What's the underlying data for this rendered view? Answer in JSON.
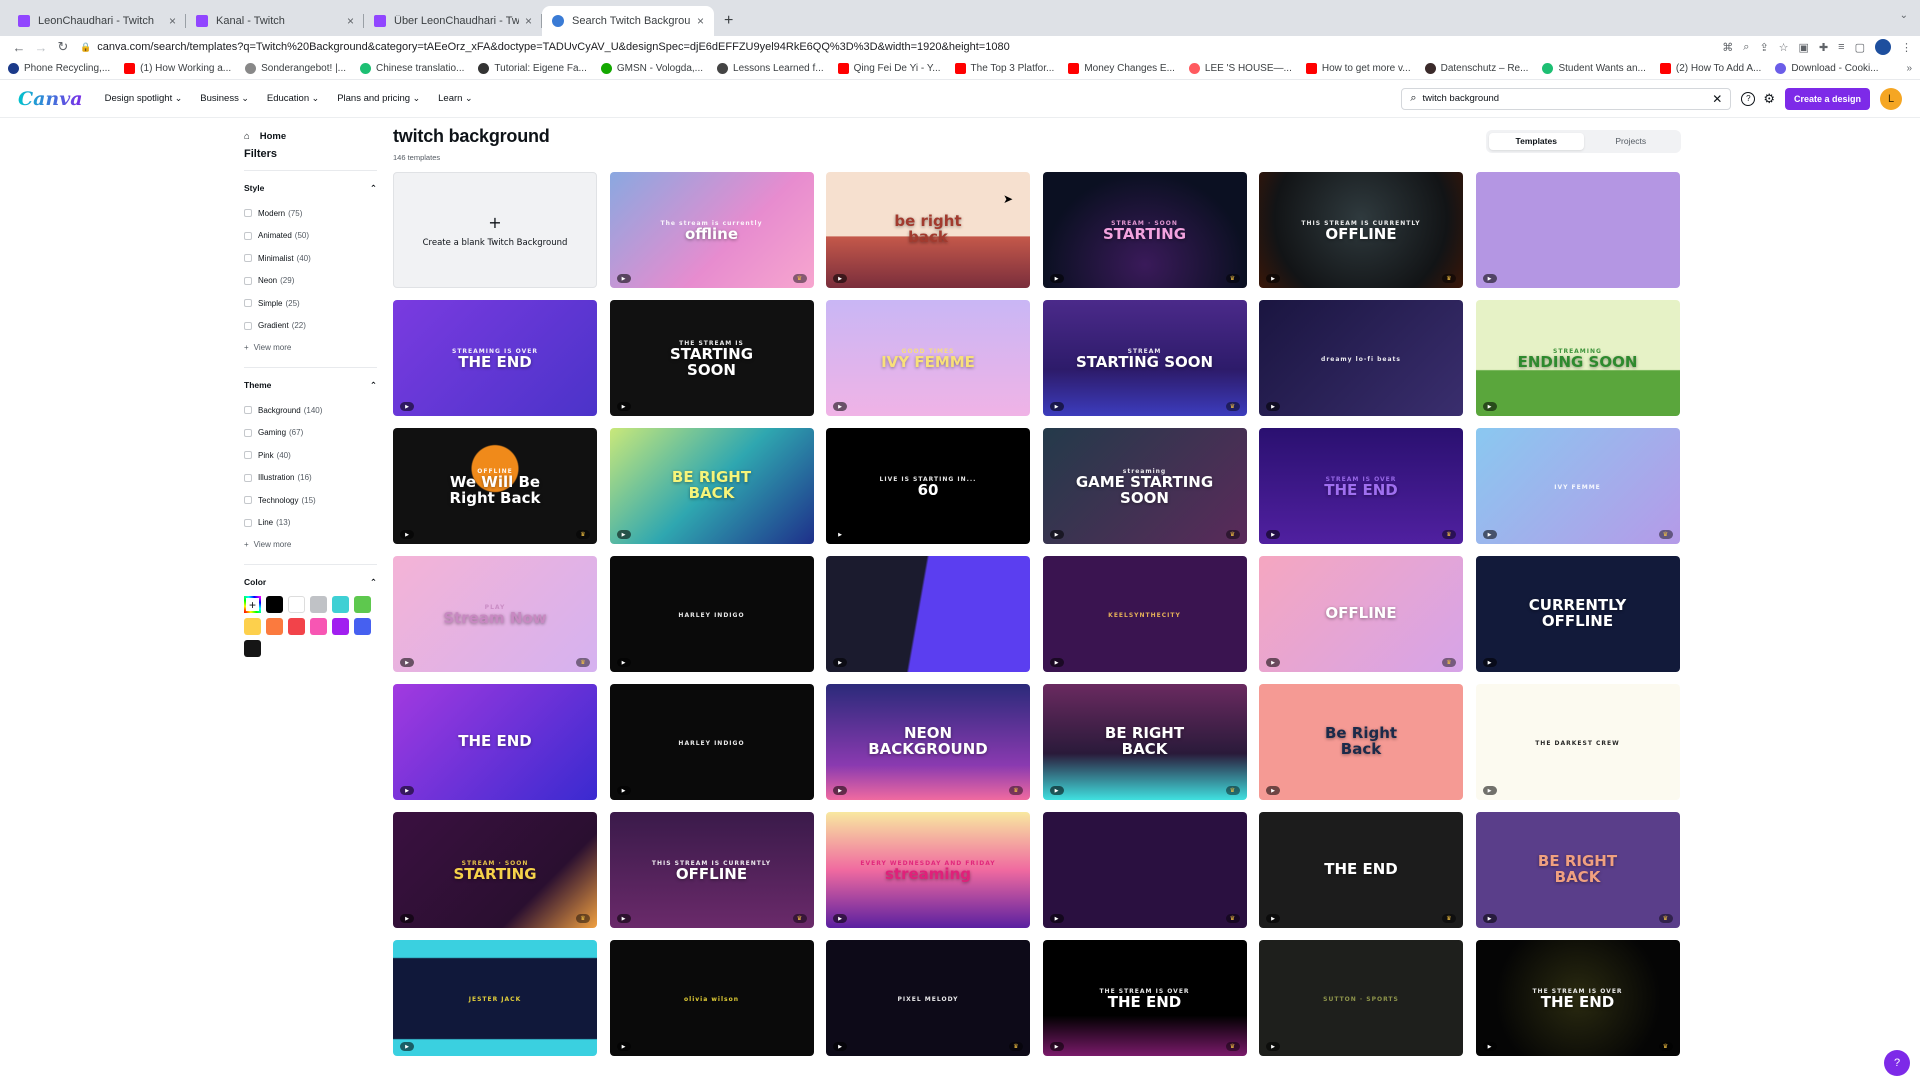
{
  "browser": {
    "tabs": [
      {
        "title": "LeonChaudhari - Twitch",
        "icon": "twitch-icon",
        "active": false
      },
      {
        "title": "Kanal - Twitch",
        "icon": "twitch-icon",
        "active": false
      },
      {
        "title": "Über LeonChaudhari - Twitch",
        "icon": "twitch-icon",
        "active": false
      },
      {
        "title": "Search Twitch Background - C",
        "icon": "canva-icon",
        "active": true
      }
    ],
    "close_glyph": "×",
    "new_tab_glyph": "+",
    "url_host": "canva.com",
    "url_rest": "/search/templates?q=Twitch%20Background&category=tAEeOrz_xFA&doctype=TADUvCyAV_U&designSpec=djE6dEFFZU9yel94RkE6QQ%3D%3D&width=1920&height=1080",
    "bookmarks": [
      {
        "label": "Phone Recycling,...",
        "icon": "o2-icon"
      },
      {
        "label": "(1) How Working a...",
        "icon": "youtube-icon"
      },
      {
        "label": "Sonderangebot! |...",
        "icon": "globe-icon"
      },
      {
        "label": "Chinese translatio...",
        "icon": "fiverr-icon"
      },
      {
        "label": "Tutorial: Eigene Fa...",
        "icon": "hashtag-icon"
      },
      {
        "label": "GMSN - Vologda,...",
        "icon": "upwork-icon"
      },
      {
        "label": "Lessons Learned f...",
        "icon": "eir-icon"
      },
      {
        "label": "Qing Fei De Yi - Y...",
        "icon": "youtube-icon"
      },
      {
        "label": "The Top 3 Platfor...",
        "icon": "youtube-icon"
      },
      {
        "label": "Money Changes E...",
        "icon": "youtube-icon"
      },
      {
        "label": "LEE 'S HOUSE—...",
        "icon": "airbnb-icon"
      },
      {
        "label": "How to get more v...",
        "icon": "youtube-icon"
      },
      {
        "label": "Datenschutz – Re...",
        "icon": "image-icon"
      },
      {
        "label": "Student Wants an...",
        "icon": "teachable-icon"
      },
      {
        "label": "(2) How To Add A...",
        "icon": "youtube-icon"
      },
      {
        "label": "Download - Cooki...",
        "icon": "ring-icon"
      }
    ],
    "bookmarks_more": "»"
  },
  "header": {
    "logo": "Canva",
    "nav": [
      "Design spotlight",
      "Business",
      "Education",
      "Plans and pricing",
      "Learn"
    ],
    "search_value": "twitch background",
    "help_glyph": "?",
    "create_label": "Create a design",
    "user_initial": "L",
    "accent": "#7d2ae8"
  },
  "sidebar": {
    "home_label": "Home",
    "filters_title": "Filters",
    "style": {
      "title": "Style",
      "options": [
        {
          "label": "Modern",
          "count": "(75)"
        },
        {
          "label": "Animated",
          "count": "(50)"
        },
        {
          "label": "Minimalist",
          "count": "(40)"
        },
        {
          "label": "Neon",
          "count": "(29)"
        },
        {
          "label": "Simple",
          "count": "(25)"
        },
        {
          "label": "Gradient",
          "count": "(22)"
        }
      ],
      "view_more": "View more"
    },
    "theme": {
      "title": "Theme",
      "options": [
        {
          "label": "Background",
          "count": "(140)"
        },
        {
          "label": "Gaming",
          "count": "(67)"
        },
        {
          "label": "Pink",
          "count": "(40)"
        },
        {
          "label": "Illustration",
          "count": "(16)"
        },
        {
          "label": "Technology",
          "count": "(15)"
        },
        {
          "label": "Line",
          "count": "(13)"
        }
      ],
      "view_more": "View more"
    },
    "color": {
      "title": "Color",
      "swatches": [
        "#000000",
        "#ffffff",
        "#c0c2c6",
        "#3fd0d4",
        "#5ec84e",
        "#fdd04c",
        "#fb7a3e",
        "#f2434a",
        "#f756b3",
        "#a11ff0",
        "#4660f0",
        "#151515"
      ]
    }
  },
  "main": {
    "title": "twitch background",
    "count": "146 templates",
    "tabs": [
      "Templates",
      "Projects"
    ],
    "blank_label": "Create a blank Twitch Background",
    "templates": [
      {
        "label": "offline",
        "sub": "The stream is currently",
        "bg": "linear-gradient(135deg,#8aa8e0,#e78ccf 60%,#f7a6cf)",
        "fg": "#fff",
        "crown": true
      },
      {
        "label": "be right\nback",
        "sub": "",
        "bg": "linear-gradient(180deg,#f6e0cf 55%,#c4584a 56%,#7a2e3c)",
        "fg": "#a23a2e",
        "crown": false
      },
      {
        "label": "STARTING",
        "sub": "STREAM · SOON",
        "bg": "radial-gradient(ellipse at 50% 80%,#3a1a5a,#0b1022 70%)",
        "fg": "#f3a3df",
        "crown": true
      },
      {
        "label": "OFFLINE",
        "sub": "THIS STREAM IS CURRENTLY",
        "bg": "radial-gradient(circle at 50% 40%,#2f3a3e,#121416 70%,#3a1608)",
        "fg": "#fff",
        "crown": true
      },
      {
        "label": "",
        "sub": "",
        "bg": "#b496e3",
        "fg": "#fff",
        "crown": false
      },
      {
        "label": "THE END",
        "sub": "STREAMING IS OVER",
        "bg": "linear-gradient(135deg,#7a3be0,#4b33c9)",
        "fg": "#fff",
        "crown": false
      },
      {
        "label": "STARTING\nSOON",
        "sub": "THE STREAM IS",
        "bg": "#111",
        "fg": "#fff",
        "crown": false
      },
      {
        "label": "IVY FEMME",
        "sub": "GOOD TIMES",
        "bg": "linear-gradient(180deg,#c9b6f5,#f0b3e6)",
        "fg": "#f8e07a",
        "crown": false
      },
      {
        "label": "STARTING SOON",
        "sub": "STREAM",
        "bg": "linear-gradient(180deg,#4b2a8a,#2d1b6a 60%,#3c3cbd)",
        "fg": "#fff",
        "crown": true
      },
      {
        "label": "",
        "sub": "dreamy lo-fi beats",
        "bg": "linear-gradient(135deg,#1a1540,#3a2e6e)",
        "fg": "#fff",
        "crown": false
      },
      {
        "label": "ENDING SOON",
        "sub": "STREAMING",
        "bg": "linear-gradient(180deg,#e6f2c6 60%,#5aa63c 61%)",
        "fg": "#2e8a2e",
        "crown": false
      },
      {
        "label": "We Will Be\nRight Back",
        "sub": "OFFLINE",
        "bg": "radial-gradient(circle at 50% 35%,#f08a1a 18%,#111 19%)",
        "fg": "#fff",
        "crown": true
      },
      {
        "label": "BE RIGHT\nBACK",
        "sub": "",
        "bg": "linear-gradient(135deg,#c9e87a,#2fa7b0 50%,#1e2f8a)",
        "fg": "#f6f57a",
        "crown": false
      },
      {
        "label": "60",
        "sub": "LIVE IS STARTING IN...",
        "bg": "#000",
        "fg": "#fff",
        "crown": false
      },
      {
        "label": "GAME STARTING\nSOON",
        "sub": "streaming",
        "bg": "linear-gradient(135deg,#243a4a,#5a2a5a)",
        "fg": "#fff",
        "crown": true
      },
      {
        "label": "THE END",
        "sub": "STREAM IS OVER",
        "bg": "linear-gradient(180deg,#2a1070,#5020a0)",
        "fg": "#a070f0",
        "crown": true
      },
      {
        "label": "",
        "sub": "IVY FEMME",
        "bg": "linear-gradient(135deg,#8ac8f0,#b59ae8)",
        "fg": "#fff",
        "crown": true
      },
      {
        "label": "Stream Now",
        "sub": "PLAY",
        "bg": "linear-gradient(135deg,#f4b3d6,#d5b2f0)",
        "fg": "#c889c2",
        "crown": true
      },
      {
        "label": "",
        "sub": "HARLEY INDIGO",
        "bg": "#0a0a0a",
        "fg": "#fff",
        "crown": false
      },
      {
        "label": "",
        "sub": "",
        "bg": "linear-gradient(100deg,#1b1b2e 45%,#5b3ef0 46%)",
        "fg": "#fff",
        "crown": false
      },
      {
        "label": "",
        "sub": "KEELSYNTHECITY",
        "bg": "#3a1450",
        "fg": "#f6c05a",
        "crown": false
      },
      {
        "label": "OFFLINE",
        "sub": "",
        "bg": "linear-gradient(135deg,#f5a6c0,#d6a4e8)",
        "fg": "#fff",
        "crown": true
      },
      {
        "label": "CURRENTLY\nOFFLINE",
        "sub": "",
        "bg": "#121a3a",
        "fg": "#fff",
        "crown": false
      },
      {
        "label": "THE END",
        "sub": "",
        "bg": "linear-gradient(135deg,#a23ae0,#3a2ad0)",
        "fg": "#fff",
        "crown": false
      },
      {
        "label": "",
        "sub": "HARLEY INDIGO",
        "bg": "#0a0a0a",
        "fg": "#fff",
        "crown": false
      },
      {
        "label": "NEON\nBACKGROUND",
        "sub": "",
        "bg": "linear-gradient(180deg,#2b2a7a,#8a3ab0 70%,#f06aa0)",
        "fg": "#fff",
        "crown": true
      },
      {
        "label": "BE RIGHT\nBACK",
        "sub": "",
        "bg": "linear-gradient(180deg,#6a2a60,#2a1a3a 60%,#40e0e0)",
        "fg": "#fff",
        "crown": true
      },
      {
        "label": "Be Right\nBack",
        "sub": "",
        "bg": "#f59a94",
        "fg": "#1b2a4a",
        "crown": false
      },
      {
        "label": "",
        "sub": "THE DARKEST CREW",
        "bg": "#fcfaf0",
        "fg": "#111",
        "crown": false
      },
      {
        "label": "STARTING",
        "sub": "STREAM · SOON",
        "bg": "linear-gradient(135deg,#3a1040,#2a0f30 70%,#f0a040)",
        "fg": "#f6d24a",
        "crown": true
      },
      {
        "label": "OFFLINE",
        "sub": "THIS STREAM IS CURRENTLY",
        "bg": "linear-gradient(180deg,#3a1a4a,#6a2a6a)",
        "fg": "#fff",
        "crown": true
      },
      {
        "label": "streaming",
        "sub": "EVERY WEDNESDAY AND FRIDAY",
        "bg": "linear-gradient(180deg,#f8e8a0,#f06aa0 50%,#5a20a0)",
        "fg": "#e0207a",
        "crown": false
      },
      {
        "label": "",
        "sub": "",
        "bg": "#2a1040",
        "fg": "#fff",
        "crown": true
      },
      {
        "label": "THE END",
        "sub": "",
        "bg": "#1c1c1c",
        "fg": "#fff",
        "crown": true
      },
      {
        "label": "BE RIGHT\nBACK",
        "sub": "",
        "bg": "#5a3e8a",
        "fg": "#f0a080",
        "crown": true
      },
      {
        "label": "",
        "sub": "JESTER JACK",
        "bg": "linear-gradient(180deg,#3ad0e0 15%,#10183a 16%,#10183a 85%,#3ad0e0 86%)",
        "fg": "#f6e03a",
        "crown": false
      },
      {
        "label": "",
        "sub": "olivia wilson",
        "bg": "#0a0a0a",
        "fg": "#f6e03a",
        "crown": false
      },
      {
        "label": "",
        "sub": "PIXEL MELODY",
        "bg": "#0d0a18",
        "fg": "#fff",
        "crown": true
      },
      {
        "label": "THE END",
        "sub": "THE STREAM IS OVER",
        "bg": "linear-gradient(180deg,#000 65%,#7a1a6a)",
        "fg": "#fff",
        "crown": true
      },
      {
        "label": "",
        "sub": "SUTTON · SPORTS",
        "bg": "#1e1f1c",
        "fg": "#9aa050",
        "crown": false
      },
      {
        "label": "THE END",
        "sub": "THE STREAM IS OVER",
        "bg": "radial-gradient(circle,#2a2a10,#050505 70%)",
        "fg": "#fff",
        "crown": true
      }
    ]
  },
  "help_fab": "?"
}
